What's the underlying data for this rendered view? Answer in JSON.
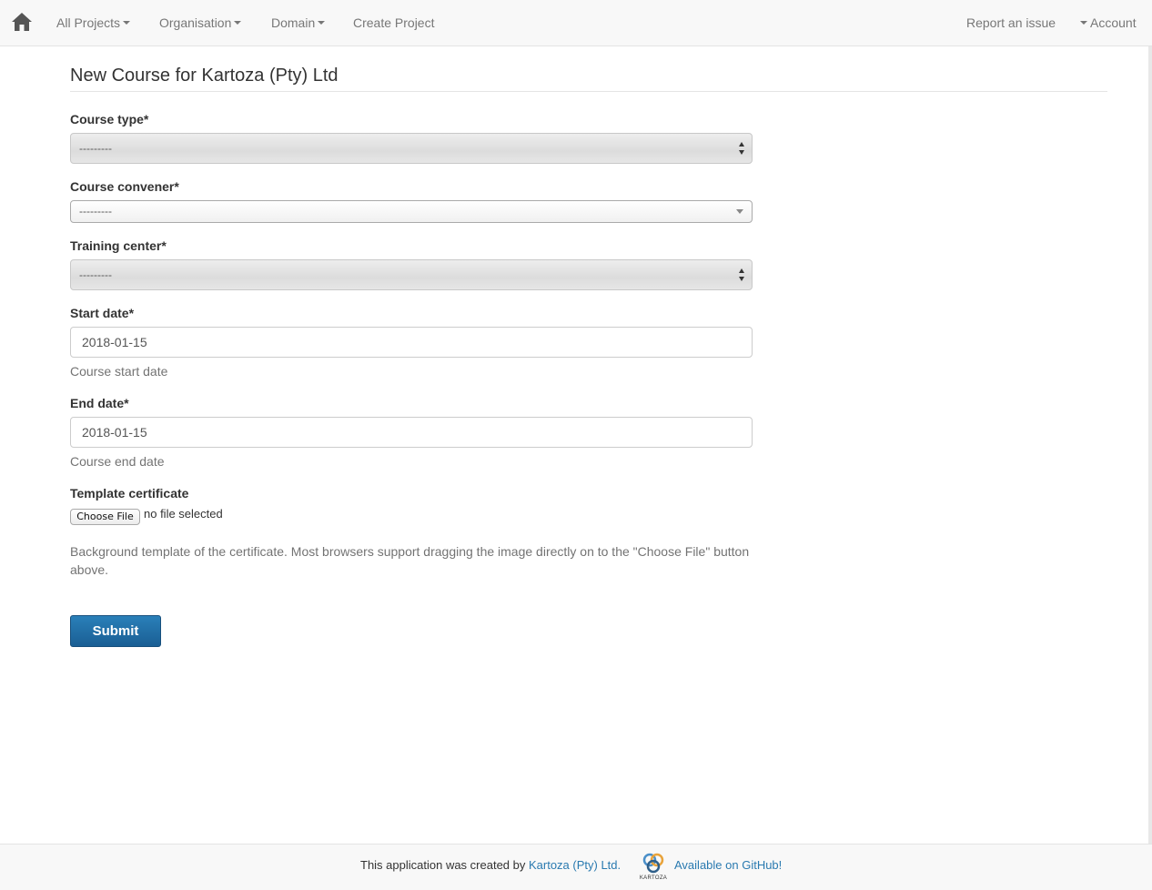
{
  "nav": {
    "home_icon": "home-icon",
    "items": [
      {
        "label": "All Projects",
        "dropdown": true
      },
      {
        "label": "Organisation",
        "dropdown": true
      },
      {
        "label": "Domain",
        "dropdown": true
      },
      {
        "label": "Create Project",
        "dropdown": false
      }
    ],
    "report_issue": "Report an issue",
    "account": "Account"
  },
  "page": {
    "title": "New Course for Kartoza (Pty) Ltd"
  },
  "form": {
    "course_type": {
      "label": "Course type*",
      "value": "---------"
    },
    "course_convener": {
      "label": "Course convener*",
      "value": "---------"
    },
    "training_center": {
      "label": "Training center*",
      "value": "---------"
    },
    "start_date": {
      "label": "Start date*",
      "value": "2018-01-15",
      "help": "Course start date"
    },
    "end_date": {
      "label": "End date*",
      "value": "2018-01-15",
      "help": "Course end date"
    },
    "template_certificate": {
      "label": "Template certificate",
      "button": "Choose File",
      "status": "no file selected",
      "help": "Background template of the certificate. Most browsers support dragging the image directly on to the \"Choose File\" button above."
    },
    "submit": "Submit"
  },
  "footer": {
    "prefix": "This application was created by ",
    "company_link": "Kartoza (Pty) Ltd.",
    "logo_text": "KARTOZA",
    "github_link": "Available on GitHub!"
  },
  "colors": {
    "link": "#2a7ab0",
    "submit": "#1f6ea5",
    "navbar_bg": "#f8f8f8"
  }
}
